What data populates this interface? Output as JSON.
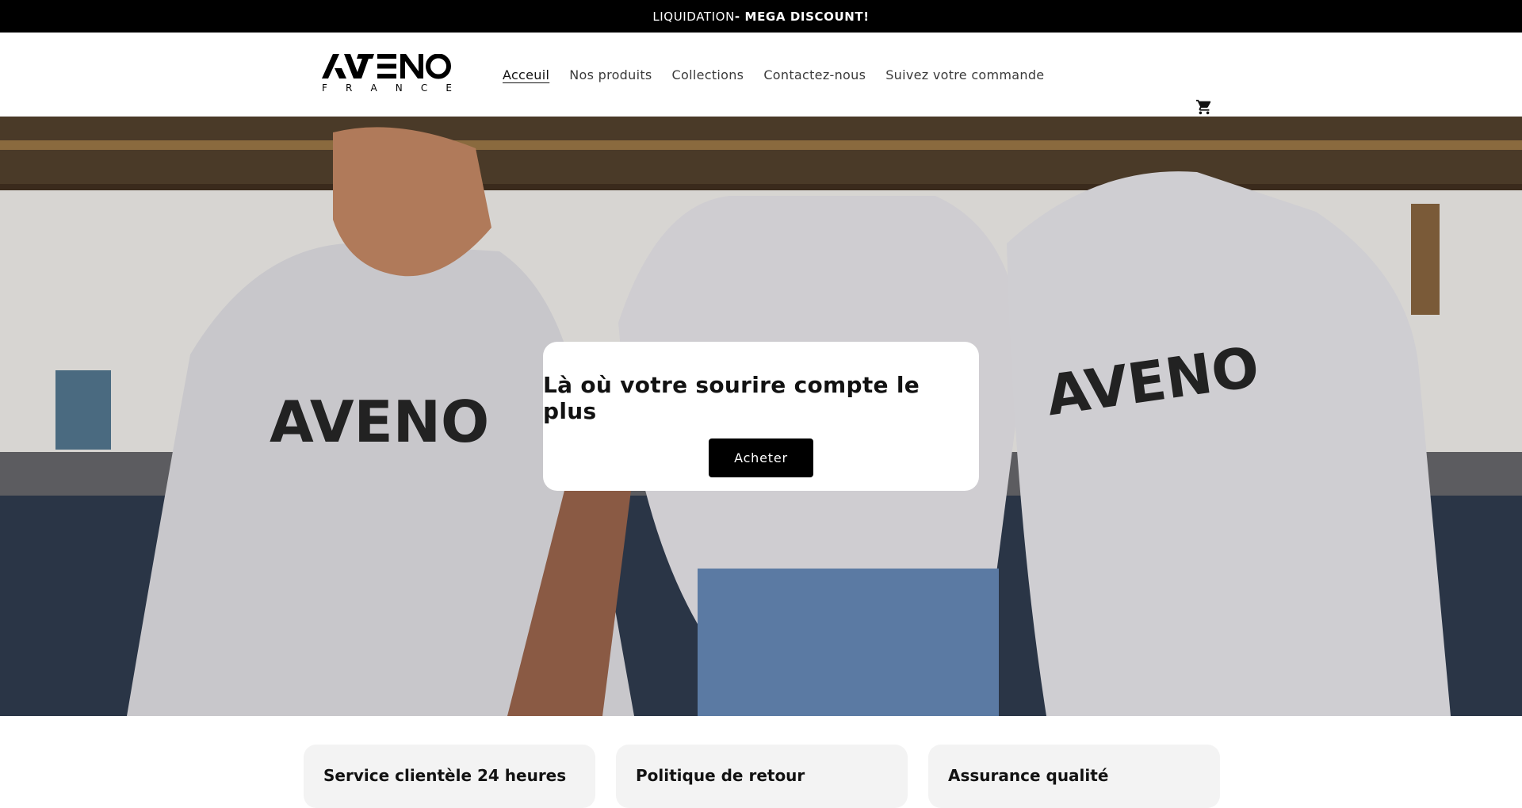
{
  "announcement": {
    "text": "LIQUIDATION ",
    "bold": "- MEGA DISCOUNT!"
  },
  "header": {
    "logo": {
      "brand": "AVENO",
      "sub": "F R A N C E"
    },
    "nav": [
      {
        "label": "Acceuil",
        "active": true
      },
      {
        "label": "Nos produits"
      },
      {
        "label": "Collections"
      },
      {
        "label": "Contactez-nous"
      },
      {
        "label": "Suivez votre commande"
      }
    ],
    "cart_icon": "cart-icon"
  },
  "hero": {
    "title": "Là où votre sourire compte le plus",
    "button": "Acheter",
    "shirt_print": "AVENO"
  },
  "features": [
    {
      "title": "Service clientèle 24 heures"
    },
    {
      "title": "Politique de retour"
    },
    {
      "title": "Assurance qualité"
    }
  ],
  "colors": {
    "announcement_bg": "#000000",
    "button_bg": "#000000",
    "card_bg": "#ffffff",
    "feature_bg": "#f3f3f3"
  }
}
